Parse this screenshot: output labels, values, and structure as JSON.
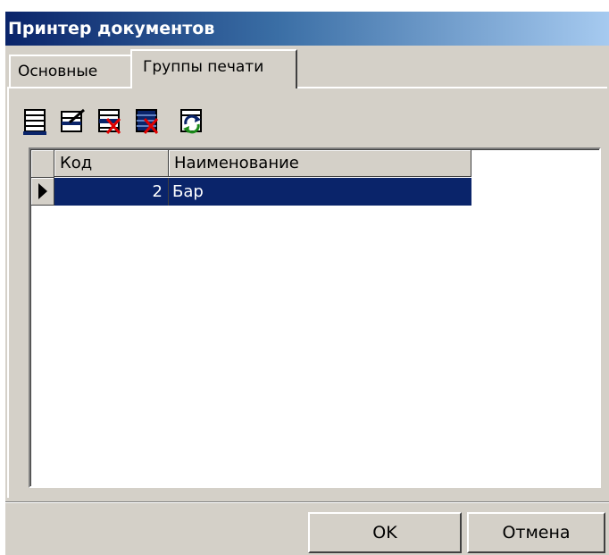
{
  "window": {
    "title": "Принтер документов"
  },
  "tabs": [
    {
      "label": "Основные",
      "active": false
    },
    {
      "label": "Группы печати",
      "active": true
    }
  ],
  "toolbar": {
    "buttons": [
      {
        "icon": "add-record-icon"
      },
      {
        "icon": "edit-record-icon"
      },
      {
        "icon": "delete-record-icon"
      },
      {
        "icon": "delete-all-records-icon"
      },
      {
        "icon": "refresh-icon"
      }
    ]
  },
  "grid": {
    "columns": [
      "Код",
      "Наименование"
    ],
    "rows": [
      {
        "code": "2",
        "name": "Бар",
        "selected": true
      }
    ]
  },
  "buttons": {
    "ok": "OK",
    "cancel": "Отмена"
  },
  "colors": {
    "selection": "#0a246a",
    "face": "#d4d0c8",
    "title_start": "#0a246a",
    "title_end": "#a6caf0"
  }
}
